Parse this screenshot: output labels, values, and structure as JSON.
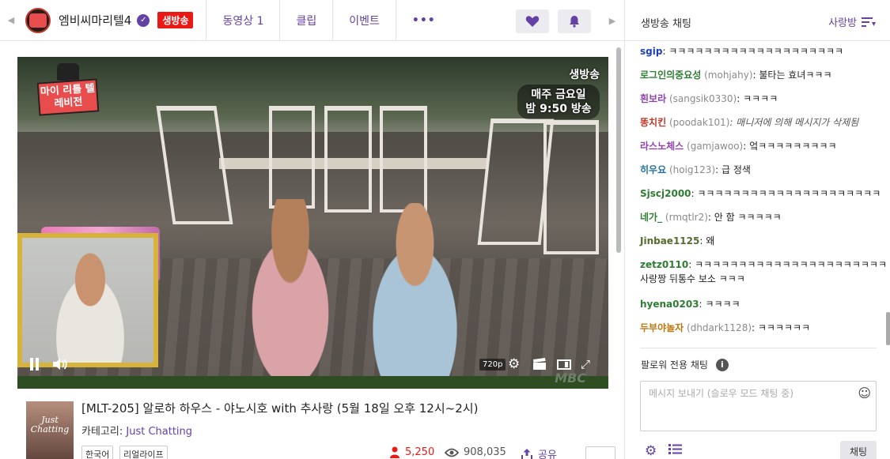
{
  "header": {
    "channel_name": "엠비씨마리텔4",
    "live_label": "생방송",
    "tabs": [
      {
        "label": "동영상 1"
      },
      {
        "label": "클립"
      },
      {
        "label": "이벤트"
      },
      {
        "label": "•••"
      }
    ]
  },
  "video": {
    "program_logo": "마이 리틀 텔레비전",
    "live_overlay": "생방송",
    "schedule_line1": "매주 금요일",
    "schedule_line2": "밤 9:50 방송",
    "watermark": "MBC",
    "quality": "720p"
  },
  "stream_info": {
    "thumbnail_text": "Just Chatting",
    "title": "[MLT-205] 알로하 하우스 - 야노시호 with 추사랑 (5월 18일 오후 12시~2시)",
    "category_label": "카테고리:",
    "category_value": "Just Chatting",
    "tags": [
      "한국어",
      "리얼라이프"
    ],
    "viewers": "5,250",
    "views": "908,035",
    "share_label": "공유"
  },
  "chat": {
    "title": "생방송 채팅",
    "room_label": "사랑방",
    "messages": [
      {
        "nick": "sgip",
        "id": "",
        "text": ": ㅋㅋㅋㅋㅋㅋㅋㅋㅋㅋㅋㅋㅋㅋㅋㅋㅋㅋㅋㅋ",
        "color": "#1e3fbd"
      },
      {
        "nick": "로그인의중요성",
        "id": "(mohjahy)",
        "text": ": 불타는 효녀ㅋㅋㅋ",
        "color": "#2e7d32"
      },
      {
        "nick": "흰보라",
        "id": "(sangsik0330)",
        "text": ": ㅋㅋㅋㅋ",
        "color": "#8e44ad"
      },
      {
        "nick": "똥치킨",
        "id": "(poodak101)",
        "text": ": 매니저에 의해 메시지가 삭제됨",
        "color": "#c0392b",
        "deleted": true
      },
      {
        "nick": "라스노체스",
        "id": "(gamjawoo)",
        "text": ": 엌ㅋㅋㅋㅋㅋㅋㅋㅋㅋ",
        "color": "#8e44ad"
      },
      {
        "nick": "히우요",
        "id": "(hoig123)",
        "text": ": 급 정색",
        "color": "#2471a3"
      },
      {
        "nick": "Sjscj2000",
        "id": "",
        "text": ": ㅋㅋㅋㅋㅋㅋㅋㅋㅋㅋㅋㅋㅋㅋㅋㅋㅋㅋㅋㅋㅋ",
        "color": "#2e7d32"
      },
      {
        "nick": "네가_",
        "id": "(rmqtlr2)",
        "text": ": 안 함 ㅋㅋㅋㅋㅋ",
        "color": "#2e7d32"
      },
      {
        "nick": "Jinbae1125",
        "id": "",
        "text": ": 왜",
        "color": "#556b2f"
      },
      {
        "nick": "zetz0110",
        "id": "",
        "text": ": ㅋㅋㅋㅋㅋㅋㅋㅋㅋㅋㅋㅋㅋㅋㅋㅋㅋㅋㅋㅋㅋㅋ",
        "text2": "사랑짱 뒤통수 보소 ㅋㅋㅋ",
        "color": "#2e7d32"
      },
      {
        "nick": "hyena0203",
        "id": "",
        "text": ": ㅋㅋㅋㅋ",
        "color": "#2e7d32"
      },
      {
        "nick": "두부야놀자",
        "id": "(dhdark1128)",
        "text": ": ㅋㅋㅋㅋㅋㅋ",
        "color": "#b9770e"
      }
    ],
    "follower_only_label": "팔로워 전용 채팅",
    "input_placeholder": "메시지 보내기 (슬로우 모드 채팅 중)",
    "send_label": "채팅"
  },
  "colors": {
    "accent": "#6441a5",
    "live": "#e91916"
  }
}
